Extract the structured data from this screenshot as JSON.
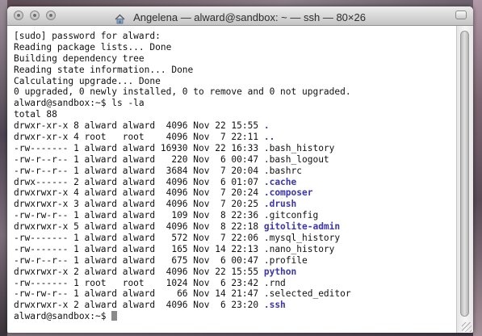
{
  "window": {
    "title": "Angelena — alward@sandbox: ~ — ssh — 80×26",
    "icons": {
      "close": "close-button",
      "minimize": "minimize-button",
      "zoom": "zoom-button",
      "home": "home-folder-icon"
    }
  },
  "terminal": {
    "lines": [
      {
        "text": "[sudo] password for alward:"
      },
      {
        "text": "Reading package lists... Done"
      },
      {
        "text": "Building dependency tree"
      },
      {
        "text": "Reading state information... Done"
      },
      {
        "text": "Calculating upgrade... Done"
      },
      {
        "text": "0 upgraded, 0 newly installed, 0 to remove and 0 not upgraded."
      },
      {
        "text": "alward@sandbox:~$ ls -la"
      },
      {
        "text": "total 88"
      }
    ],
    "listing": [
      {
        "meta": "drwxr-xr-x 8 alward alward  4096 Nov 22 15:55 ",
        "name": ".",
        "dir": true
      },
      {
        "meta": "drwxr-xr-x 4 root   root    4096 Nov  7 22:11 ",
        "name": "..",
        "dir": true
      },
      {
        "meta": "-rw------- 1 alward alward 16930 Nov 22 16:33 ",
        "name": ".bash_history",
        "dir": false
      },
      {
        "meta": "-rw-r--r-- 1 alward alward   220 Nov  6 00:47 ",
        "name": ".bash_logout",
        "dir": false
      },
      {
        "meta": "-rw-r--r-- 1 alward alward  3684 Nov  7 20:04 ",
        "name": ".bashrc",
        "dir": false
      },
      {
        "meta": "drwx------ 2 alward alward  4096 Nov  6 01:07 ",
        "name": ".cache",
        "dir": true
      },
      {
        "meta": "drwxrwxr-x 4 alward alward  4096 Nov  7 20:24 ",
        "name": ".composer",
        "dir": true
      },
      {
        "meta": "drwxrwxr-x 3 alward alward  4096 Nov  7 20:25 ",
        "name": ".drush",
        "dir": true
      },
      {
        "meta": "-rw-rw-r-- 1 alward alward   109 Nov  8 22:36 ",
        "name": ".gitconfig",
        "dir": false
      },
      {
        "meta": "drwxrwxr-x 5 alward alward  4096 Nov  8 22:18 ",
        "name": "gitolite-admin",
        "dir": true
      },
      {
        "meta": "-rw------- 1 alward alward   572 Nov  7 22:06 ",
        "name": ".mysql_history",
        "dir": false
      },
      {
        "meta": "-rw------- 1 alward alward   165 Nov 14 22:13 ",
        "name": ".nano_history",
        "dir": false
      },
      {
        "meta": "-rw-r--r-- 1 alward alward   675 Nov  6 00:47 ",
        "name": ".profile",
        "dir": false
      },
      {
        "meta": "drwxrwxr-x 2 alward alward  4096 Nov 22 15:55 ",
        "name": "python",
        "dir": true
      },
      {
        "meta": "-rw------- 1 root   root    1024 Nov  6 23:42 ",
        "name": ".rnd",
        "dir": false
      },
      {
        "meta": "-rw-rw-r-- 1 alward alward    66 Nov 14 21:47 ",
        "name": ".selected_editor",
        "dir": false
      },
      {
        "meta": "drwxrwxr-x 2 alward alward  4096 Nov  6 23:20 ",
        "name": ".ssh",
        "dir": true
      }
    ],
    "prompt": "alward@sandbox:~$ ",
    "directory_color": "#3a35b8",
    "text_color": "#111111",
    "background_color": "#ffffff"
  }
}
